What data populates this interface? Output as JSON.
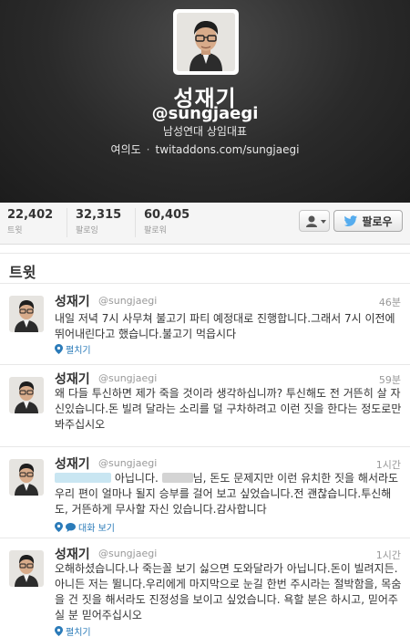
{
  "profile": {
    "name": "성재기",
    "handle": "@sungjaegi",
    "bio": "남성연대 상임대표",
    "location": "여의도",
    "url": "twitaddons.com/sungjaegi"
  },
  "stats": [
    {
      "value": "22,402",
      "label": "트윗"
    },
    {
      "value": "32,315",
      "label": "팔로잉"
    },
    {
      "value": "60,405",
      "label": "팔로워"
    }
  ],
  "actions": {
    "follow_label": "팔로우",
    "user_menu_icon": "user-icon"
  },
  "tweets_section": {
    "title": "트윗"
  },
  "tweets": [
    {
      "name": "성재기",
      "handle": "@sungjaegi",
      "time": "46분",
      "text": "내일 저녁 7시 사무쳐 불고기 파티 예정대로 진행합니다.그래서 7시 이전에 뛰어내린다고 했습니다.불고기 먹읍시다",
      "action": "펼치기"
    },
    {
      "name": "성재기",
      "handle": "@sungjaegi",
      "time": "59분",
      "text": "왜 다들 투신하면 제가 죽을 것이라 생각하십니까? 투신해도 전 거뜬히 살 자신있습니다.돈 빌려 달라는 소리를 덜 구차하려고 이런 짓을 한다는 정도로만 봐주십시오",
      "action": "펼치기"
    },
    {
      "name": "성재기",
      "handle": "@sungjaegi",
      "time": "1시간",
      "text_parts": [
        "아닙니다.",
        "님, 돈도 문제지만 이런 유치한 짓을 해서라도 우리 편이 얼마나 될지 승부를 걸어 보고 싶었습니다.전 괜찮습니다.투신해도, 거뜬하게 무사할 자신 있습니다.감사합니다"
      ],
      "action": "대화 보기"
    },
    {
      "name": "성재기",
      "handle": "@sungjaegi",
      "time": "1시간",
      "text": "오해하셨습니다.나 죽는꼴 보기 싫으면 도와달라가 아닙니다.돈이 빌려지든. 아니든 저는 뛸니다.우리에게 마지막으로 눈길 한번 주시라는 절박함을, 목숨을 건 짓을 해서라도 진정성을 보이고 싶었습니다. 욕할 분은 하시고, 믿어주실 분 믿어주십시오",
      "action": "펼치기"
    }
  ],
  "colors": {
    "link": "#2b7bb9",
    "header_bg": "#2a2a2a",
    "twitter_blue": "#55acee"
  }
}
